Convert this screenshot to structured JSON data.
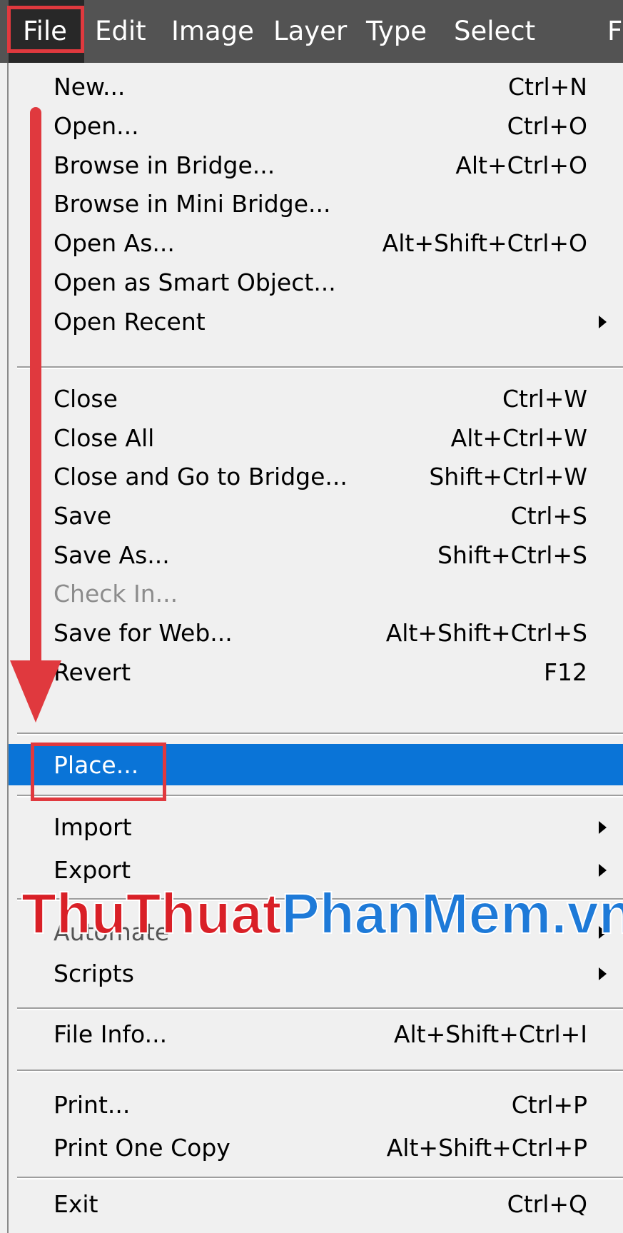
{
  "menubar": {
    "items": [
      {
        "label": "File"
      },
      {
        "label": "Edit"
      },
      {
        "label": "Image"
      },
      {
        "label": "Layer"
      },
      {
        "label": "Type"
      },
      {
        "label": "Select"
      },
      {
        "label": "F"
      }
    ],
    "active": "File"
  },
  "file_menu": {
    "items": [
      {
        "label": "New...",
        "shortcut": "Ctrl+N"
      },
      {
        "label": "Open...",
        "shortcut": "Ctrl+O"
      },
      {
        "label": "Browse in Bridge...",
        "shortcut": "Alt+Ctrl+O"
      },
      {
        "label": "Browse in Mini Bridge...",
        "shortcut": ""
      },
      {
        "label": "Open As...",
        "shortcut": "Alt+Shift+Ctrl+O"
      },
      {
        "label": "Open as Smart Object...",
        "shortcut": ""
      },
      {
        "label": "Open Recent",
        "shortcut": "",
        "submenu": true
      },
      {
        "label": "Close",
        "shortcut": "Ctrl+W"
      },
      {
        "label": "Close All",
        "shortcut": "Alt+Ctrl+W"
      },
      {
        "label": "Close and Go to Bridge...",
        "shortcut": "Shift+Ctrl+W"
      },
      {
        "label": "Save",
        "shortcut": "Ctrl+S"
      },
      {
        "label": "Save As...",
        "shortcut": "Shift+Ctrl+S"
      },
      {
        "label": "Check In...",
        "shortcut": "",
        "disabled": true
      },
      {
        "label": "Save for Web...",
        "shortcut": "Alt+Shift+Ctrl+S"
      },
      {
        "label": "Revert",
        "shortcut": "F12"
      },
      {
        "label": "Place...",
        "shortcut": "",
        "selected": true
      },
      {
        "label": "Import",
        "shortcut": "",
        "submenu": true
      },
      {
        "label": "Export",
        "shortcut": "",
        "submenu": true
      },
      {
        "label": "Automate",
        "shortcut": "",
        "submenu": true
      },
      {
        "label": "Scripts",
        "shortcut": "",
        "submenu": true
      },
      {
        "label": "File Info...",
        "shortcut": "Alt+Shift+Ctrl+I"
      },
      {
        "label": "Print...",
        "shortcut": "Ctrl+P"
      },
      {
        "label": "Print One Copy",
        "shortcut": "Alt+Shift+Ctrl+P"
      },
      {
        "label": "Exit",
        "shortcut": "Ctrl+Q"
      }
    ]
  },
  "watermark": {
    "part1": "ThuThuat",
    "part2": "PhanMem.vn"
  },
  "colors": {
    "menubar_bg": "#535353",
    "menu_bg": "#f0f0f0",
    "selection": "#0a74d7",
    "annotation_red": "#e0393e"
  }
}
